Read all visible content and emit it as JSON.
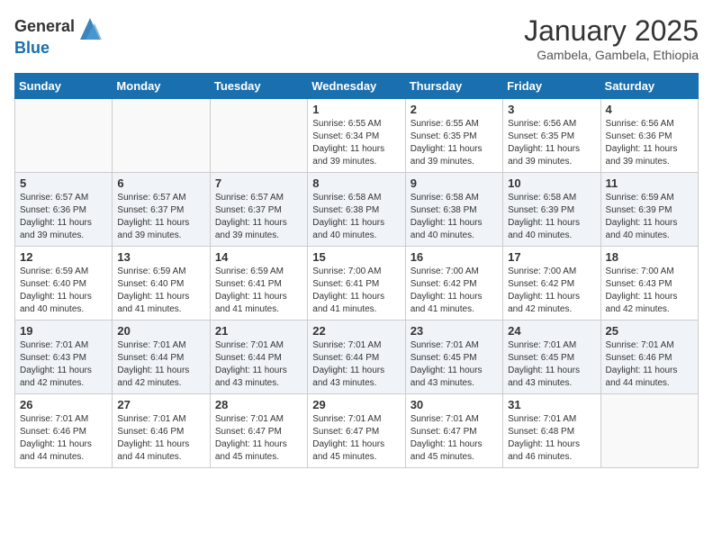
{
  "header": {
    "logo_general": "General",
    "logo_blue": "Blue",
    "month_title": "January 2025",
    "location": "Gambela, Gambela, Ethiopia"
  },
  "days_of_week": [
    "Sunday",
    "Monday",
    "Tuesday",
    "Wednesday",
    "Thursday",
    "Friday",
    "Saturday"
  ],
  "weeks": [
    [
      {
        "day": "",
        "info": ""
      },
      {
        "day": "",
        "info": ""
      },
      {
        "day": "",
        "info": ""
      },
      {
        "day": "1",
        "info": "Sunrise: 6:55 AM\nSunset: 6:34 PM\nDaylight: 11 hours\nand 39 minutes."
      },
      {
        "day": "2",
        "info": "Sunrise: 6:55 AM\nSunset: 6:35 PM\nDaylight: 11 hours\nand 39 minutes."
      },
      {
        "day": "3",
        "info": "Sunrise: 6:56 AM\nSunset: 6:35 PM\nDaylight: 11 hours\nand 39 minutes."
      },
      {
        "day": "4",
        "info": "Sunrise: 6:56 AM\nSunset: 6:36 PM\nDaylight: 11 hours\nand 39 minutes."
      }
    ],
    [
      {
        "day": "5",
        "info": "Sunrise: 6:57 AM\nSunset: 6:36 PM\nDaylight: 11 hours\nand 39 minutes."
      },
      {
        "day": "6",
        "info": "Sunrise: 6:57 AM\nSunset: 6:37 PM\nDaylight: 11 hours\nand 39 minutes."
      },
      {
        "day": "7",
        "info": "Sunrise: 6:57 AM\nSunset: 6:37 PM\nDaylight: 11 hours\nand 39 minutes."
      },
      {
        "day": "8",
        "info": "Sunrise: 6:58 AM\nSunset: 6:38 PM\nDaylight: 11 hours\nand 40 minutes."
      },
      {
        "day": "9",
        "info": "Sunrise: 6:58 AM\nSunset: 6:38 PM\nDaylight: 11 hours\nand 40 minutes."
      },
      {
        "day": "10",
        "info": "Sunrise: 6:58 AM\nSunset: 6:39 PM\nDaylight: 11 hours\nand 40 minutes."
      },
      {
        "day": "11",
        "info": "Sunrise: 6:59 AM\nSunset: 6:39 PM\nDaylight: 11 hours\nand 40 minutes."
      }
    ],
    [
      {
        "day": "12",
        "info": "Sunrise: 6:59 AM\nSunset: 6:40 PM\nDaylight: 11 hours\nand 40 minutes."
      },
      {
        "day": "13",
        "info": "Sunrise: 6:59 AM\nSunset: 6:40 PM\nDaylight: 11 hours\nand 41 minutes."
      },
      {
        "day": "14",
        "info": "Sunrise: 6:59 AM\nSunset: 6:41 PM\nDaylight: 11 hours\nand 41 minutes."
      },
      {
        "day": "15",
        "info": "Sunrise: 7:00 AM\nSunset: 6:41 PM\nDaylight: 11 hours\nand 41 minutes."
      },
      {
        "day": "16",
        "info": "Sunrise: 7:00 AM\nSunset: 6:42 PM\nDaylight: 11 hours\nand 41 minutes."
      },
      {
        "day": "17",
        "info": "Sunrise: 7:00 AM\nSunset: 6:42 PM\nDaylight: 11 hours\nand 42 minutes."
      },
      {
        "day": "18",
        "info": "Sunrise: 7:00 AM\nSunset: 6:43 PM\nDaylight: 11 hours\nand 42 minutes."
      }
    ],
    [
      {
        "day": "19",
        "info": "Sunrise: 7:01 AM\nSunset: 6:43 PM\nDaylight: 11 hours\nand 42 minutes."
      },
      {
        "day": "20",
        "info": "Sunrise: 7:01 AM\nSunset: 6:44 PM\nDaylight: 11 hours\nand 42 minutes."
      },
      {
        "day": "21",
        "info": "Sunrise: 7:01 AM\nSunset: 6:44 PM\nDaylight: 11 hours\nand 43 minutes."
      },
      {
        "day": "22",
        "info": "Sunrise: 7:01 AM\nSunset: 6:44 PM\nDaylight: 11 hours\nand 43 minutes."
      },
      {
        "day": "23",
        "info": "Sunrise: 7:01 AM\nSunset: 6:45 PM\nDaylight: 11 hours\nand 43 minutes."
      },
      {
        "day": "24",
        "info": "Sunrise: 7:01 AM\nSunset: 6:45 PM\nDaylight: 11 hours\nand 43 minutes."
      },
      {
        "day": "25",
        "info": "Sunrise: 7:01 AM\nSunset: 6:46 PM\nDaylight: 11 hours\nand 44 minutes."
      }
    ],
    [
      {
        "day": "26",
        "info": "Sunrise: 7:01 AM\nSunset: 6:46 PM\nDaylight: 11 hours\nand 44 minutes."
      },
      {
        "day": "27",
        "info": "Sunrise: 7:01 AM\nSunset: 6:46 PM\nDaylight: 11 hours\nand 44 minutes."
      },
      {
        "day": "28",
        "info": "Sunrise: 7:01 AM\nSunset: 6:47 PM\nDaylight: 11 hours\nand 45 minutes."
      },
      {
        "day": "29",
        "info": "Sunrise: 7:01 AM\nSunset: 6:47 PM\nDaylight: 11 hours\nand 45 minutes."
      },
      {
        "day": "30",
        "info": "Sunrise: 7:01 AM\nSunset: 6:47 PM\nDaylight: 11 hours\nand 45 minutes."
      },
      {
        "day": "31",
        "info": "Sunrise: 7:01 AM\nSunset: 6:48 PM\nDaylight: 11 hours\nand 46 minutes."
      },
      {
        "day": "",
        "info": ""
      }
    ]
  ]
}
